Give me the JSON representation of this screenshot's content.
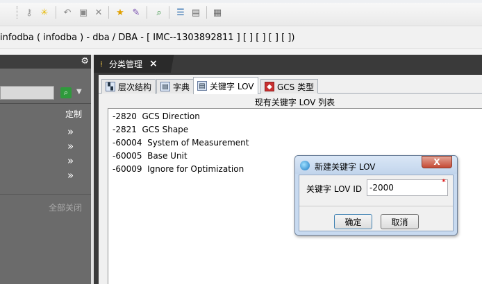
{
  "toolbar": {
    "icons": [
      "key-icon",
      "star-icon",
      "undo-icon",
      "save-icon",
      "close-icon",
      "folder-star-icon",
      "folder-edit-icon",
      "search-icon",
      "list-icon",
      "document-icon",
      "table-icon"
    ]
  },
  "info_bar": {
    "text": "infodba ( infodba ) - dba / DBA - [ IMC--1303892811 ] [ ] [ ] [ ] [ ])"
  },
  "left_panel": {
    "custom_label": "定制",
    "chevrons": [
      "»",
      "»",
      "»",
      "»"
    ],
    "close_all_label": "全部关闭"
  },
  "main_tab": {
    "label": "分类管理",
    "close": "×"
  },
  "sub_tabs": [
    {
      "label": "层次结构",
      "icon": "hierarchy-icon"
    },
    {
      "label": "字典",
      "icon": "dictionary-icon"
    },
    {
      "label": "关键字 LOV",
      "icon": "lov-icon",
      "active": true
    },
    {
      "label": "GCS 类型",
      "icon": "gcs-type-icon"
    }
  ],
  "list": {
    "title": "现有关键字 LOV 列表",
    "items": [
      "-2820  GCS Direction",
      "-2821  GCS Shape",
      "-60004  System of Measurement",
      "-60005  Base Unit",
      "-60009  Ignore for Optimization"
    ]
  },
  "dialog": {
    "title": "新建关键字 LOV",
    "close": "X",
    "field_label": "关键字 LOV ID",
    "field_value": "-2000",
    "required_mark": "*",
    "ok_label": "确定",
    "cancel_label": "取消"
  }
}
